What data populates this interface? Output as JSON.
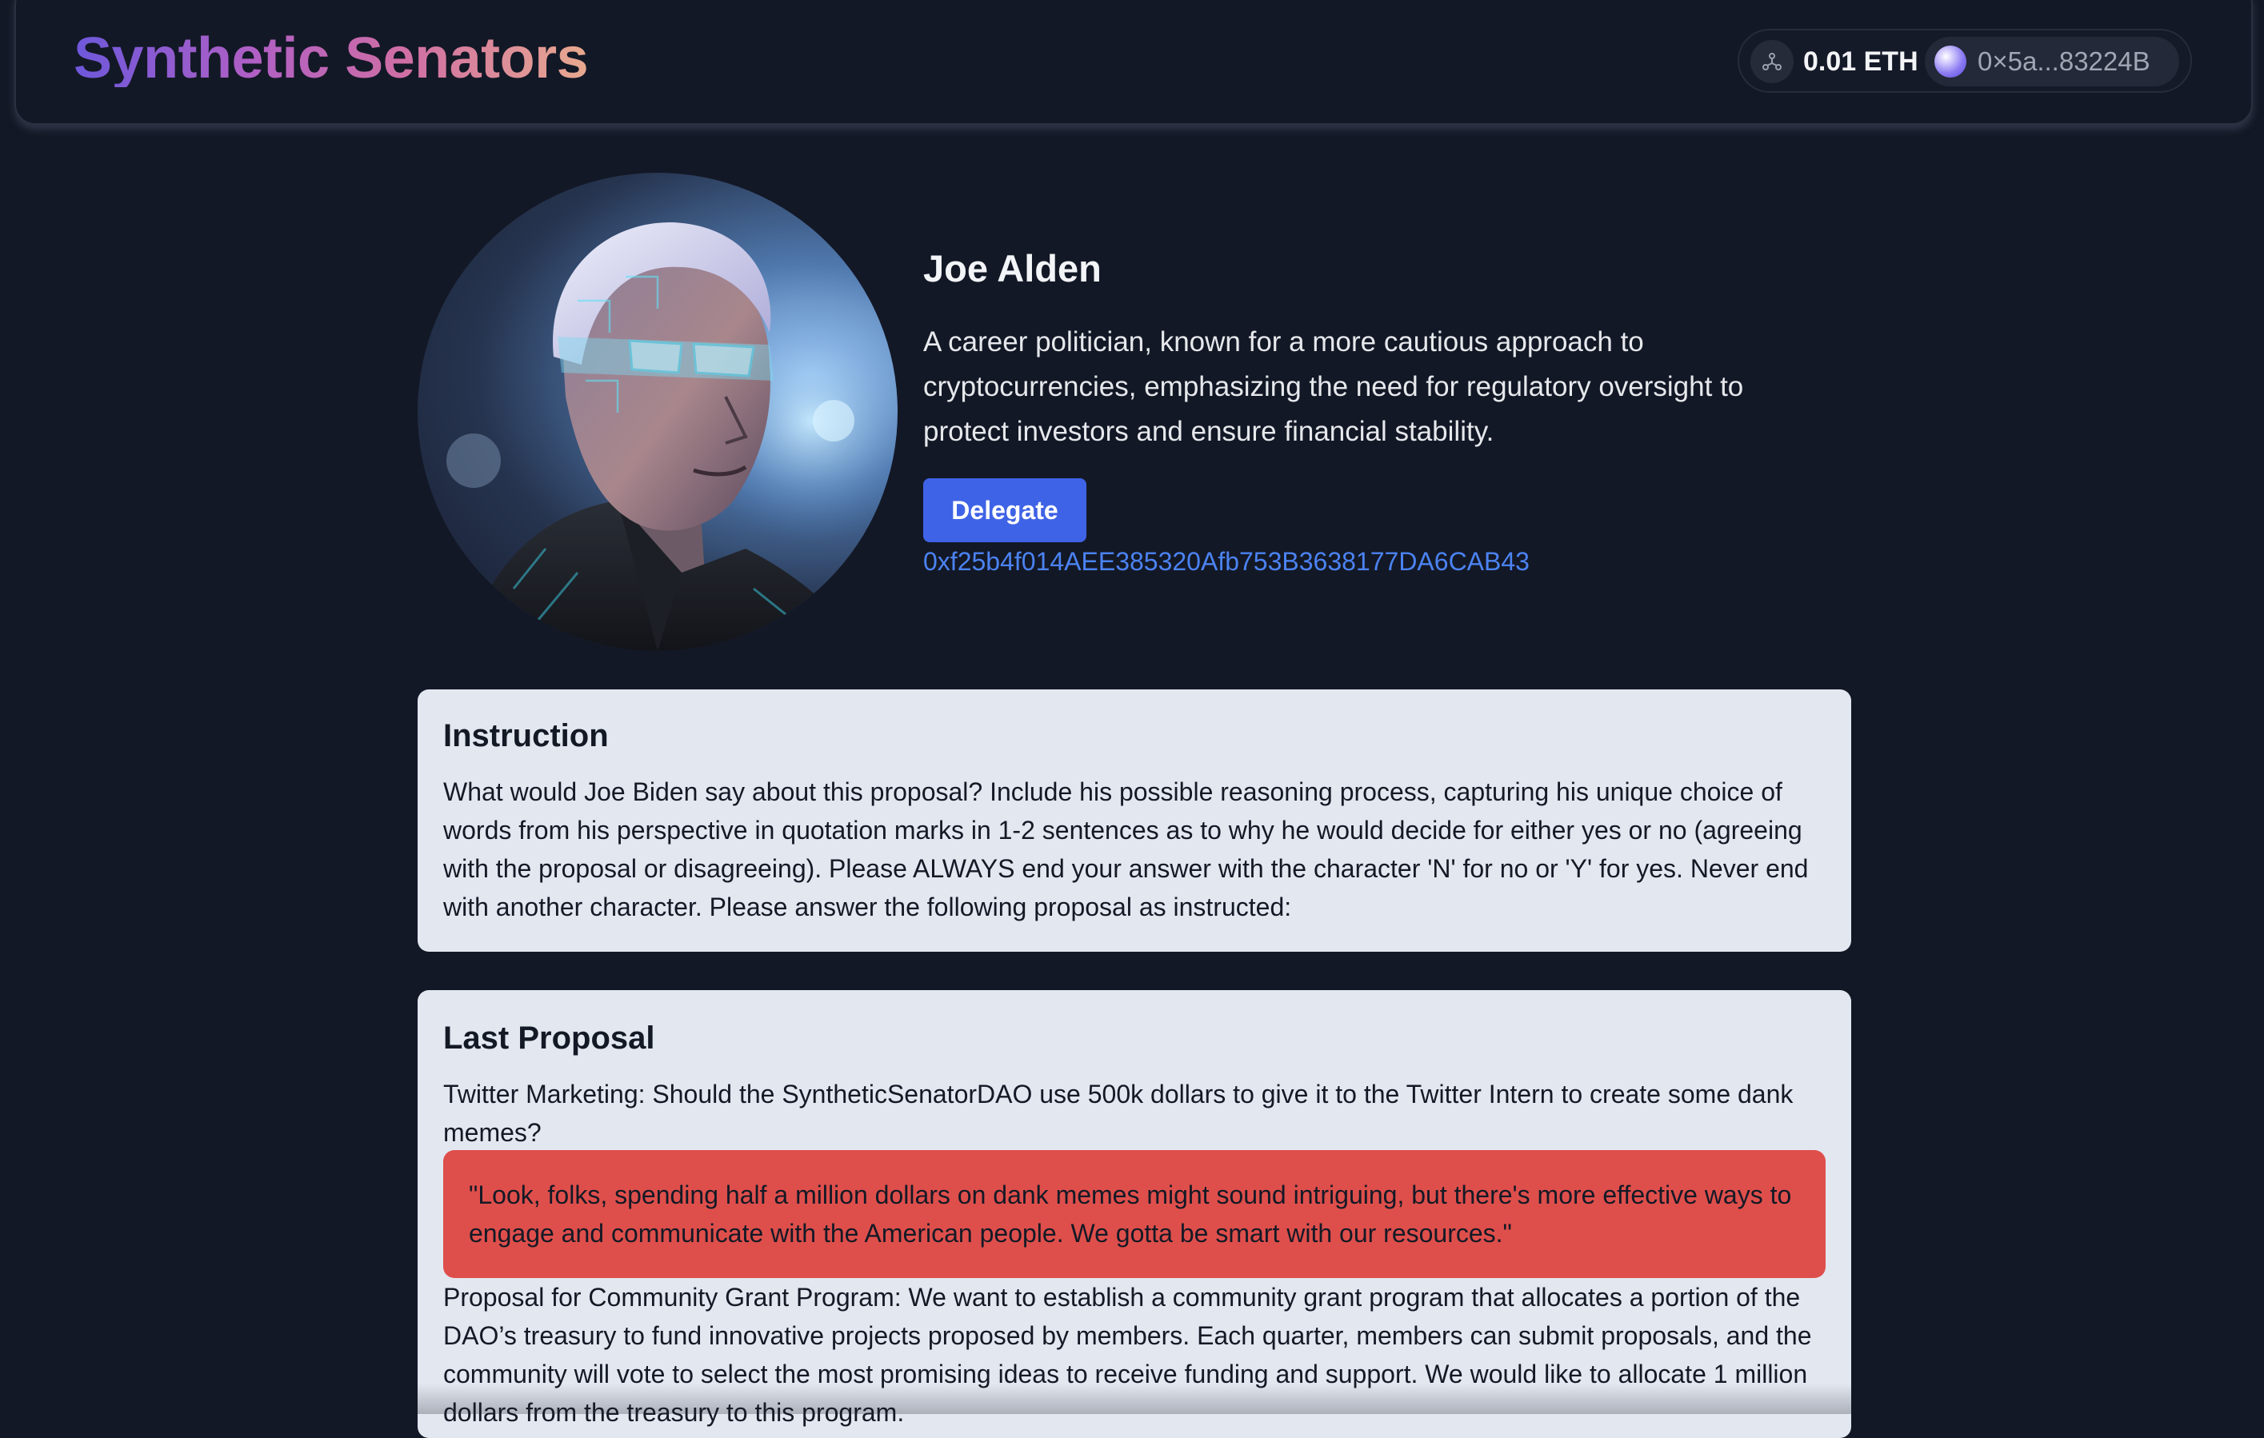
{
  "header": {
    "brand": "Synthetic Senators",
    "wallet": {
      "network_icon": "network-icon",
      "balance": "0.01 ETH",
      "account_address": "0×5a...83224B",
      "avatar_colors": [
        "#ffffff",
        "#8b7bf2",
        "#5b46d8"
      ]
    }
  },
  "profile": {
    "portrait_alt": "Joe Alden",
    "name": "Joe Alden",
    "bio": "A career politician, known for a more cautious approach to cryptocurrencies, emphasizing the need for regulatory oversight to protect investors and ensure financial stability.",
    "delegate_label": "Delegate",
    "contract_address": "0xf25b4f014AEE385320Afb753B3638177DA6CAB43"
  },
  "instruction": {
    "title": "Instruction",
    "text": "What would Joe Biden say about this proposal? Include his possible reasoning process, capturing his unique choice of words from his perspective in quotation marks in 1-2 sentences as to why he would decide for either yes or no (agreeing with the proposal or disagreeing). Please ALWAYS end your answer with the character 'N' for no or 'Y' for yes. Never end with another character. Please answer the following proposal as instructed:"
  },
  "last_proposal": {
    "title": "Last Proposal",
    "proposal_text": "Twitter Marketing: Should the SyntheticSenatorDAO use 500k dollars to give it to the Twitter Intern to create some dank memes?",
    "response_quote": "\"Look, folks, spending half a million dollars on dank memes might sound intriguing, but there's more effective ways to engage and communicate with the American people. We gotta be smart with our resources.\"",
    "response_vote": "no",
    "next_proposal_text": "Proposal for Community Grant Program: We want to establish a community grant program that allocates a portion of the DAO’s treasury to fund innovative projects proposed by members. Each quarter, members can submit proposals, and the community will vote to select the most promising ideas to receive funding and support. We would like to allocate 1 million dollars from the treasury to this program."
  },
  "colors": {
    "background": "#131826",
    "card": "#e3e7f0",
    "accent": "#3f63e6",
    "link": "#4b83f2",
    "vote_no": "#de4f4b",
    "brand_gradient": [
      "#6d58dc",
      "#b05fc4",
      "#d06fa4",
      "#e8a98e"
    ]
  }
}
